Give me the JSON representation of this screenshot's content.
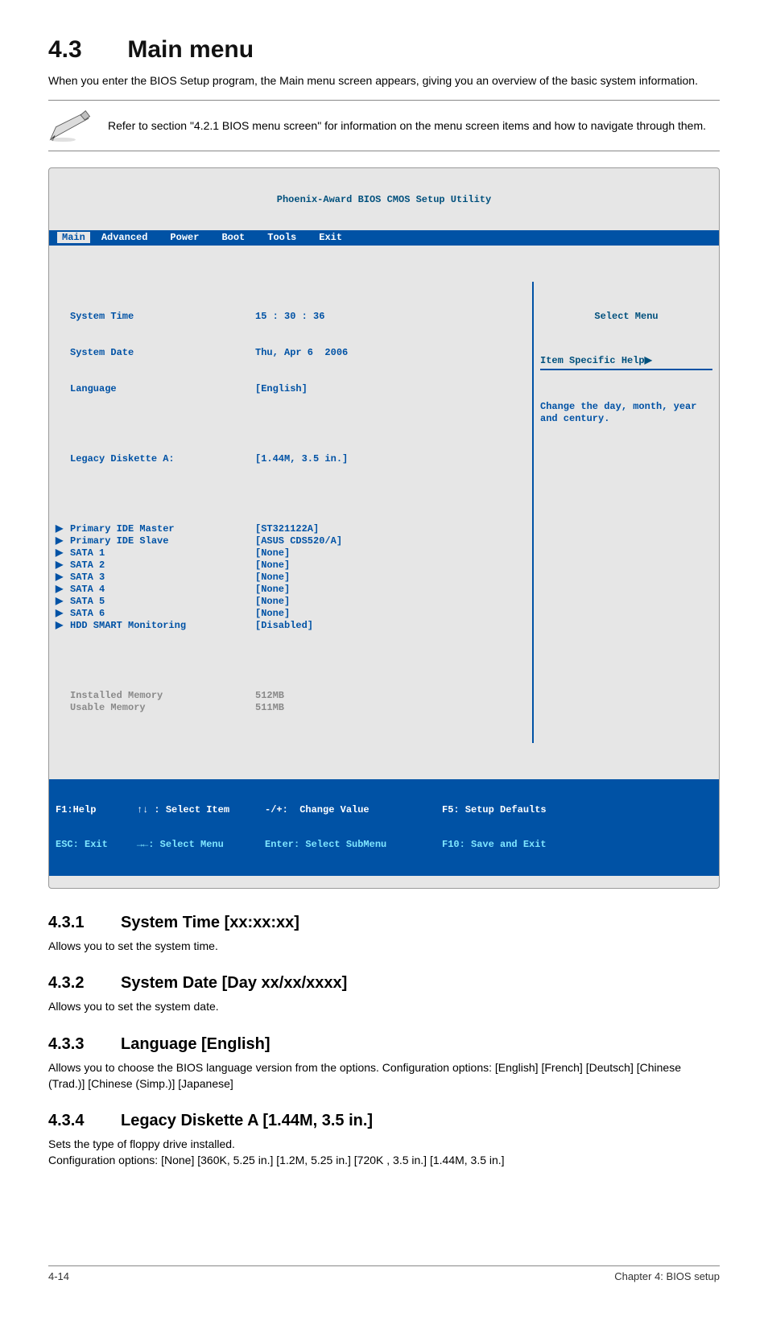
{
  "section": {
    "number": "4.3",
    "title": "Main menu"
  },
  "intro": "When you enter the BIOS Setup program, the Main menu screen appears, giving you an overview of the basic system information.",
  "note": "Refer to section \"4.2.1 BIOS menu screen\" for information on the menu screen items and how to navigate through them.",
  "bios": {
    "title": "Phoenix-Award BIOS CMOS Setup Utility",
    "menu": [
      "Main",
      "Advanced",
      "Power",
      "Boot",
      "Tools",
      "Exit"
    ],
    "active_menu": "Main",
    "fields": {
      "system_time_label": "System Time",
      "system_time_value": "15 : 30 : 36",
      "system_date_label": "System Date",
      "system_date_value": "Thu, Apr 6  2006",
      "language_label": "Language",
      "language_value": "[English]",
      "legacy_label": "Legacy Diskette A:",
      "legacy_value": "[1.44M, 3.5 in.]"
    },
    "subitems": [
      {
        "label": "Primary IDE Master",
        "value": "[ST321122A]"
      },
      {
        "label": "Primary IDE Slave",
        "value": "[ASUS CDS520/A]"
      },
      {
        "label": "SATA 1",
        "value": "[None]"
      },
      {
        "label": "SATA 2",
        "value": "[None]"
      },
      {
        "label": "SATA 3",
        "value": "[None]"
      },
      {
        "label": "SATA 4",
        "value": "[None]"
      },
      {
        "label": "SATA 5",
        "value": "[None]"
      },
      {
        "label": "SATA 6",
        "value": "[None]"
      },
      {
        "label": "HDD SMART Monitoring",
        "value": "[Disabled]"
      }
    ],
    "dim_rows": [
      {
        "label": "Installed Memory",
        "value": "512MB"
      },
      {
        "label": "Usable Memory",
        "value": "511MB"
      }
    ],
    "help": {
      "select_menu": "Select Menu",
      "item_specific": "Item Specific Help",
      "body": "Change the day, month, year and century."
    },
    "footer": {
      "line1_left": "F1:Help       ↑↓ : Select Item",
      "line1_mid": "-/+:  Change Value",
      "line1_right": "F5: Setup Defaults",
      "line2_left": "ESC: Exit     →←: Select Menu",
      "line2_mid": "Enter: Select SubMenu",
      "line2_right": "F10: Save and Exit"
    }
  },
  "subs": [
    {
      "num": "4.3.1",
      "title": "System Time [xx:xx:xx]",
      "body": "Allows you to set the system time."
    },
    {
      "num": "4.3.2",
      "title": "System Date [Day xx/xx/xxxx]",
      "body": "Allows you to set the system date."
    },
    {
      "num": "4.3.3",
      "title": "Language [English]",
      "body": "Allows you to choose the BIOS language version from the options. Configuration options: [English] [French] [Deutsch] [Chinese (Trad.)] [Chinese (Simp.)] [Japanese]"
    },
    {
      "num": "4.3.4",
      "title": "Legacy Diskette A [1.44M, 3.5 in.]",
      "body": "Sets the type of floppy drive installed.\nConfiguration options: [None] [360K, 5.25 in.]  [1.2M, 5.25 in.] [720K , 3.5 in.] [1.44M, 3.5 in.]"
    }
  ],
  "footer": {
    "left": "4-14",
    "right": "Chapter 4: BIOS setup"
  }
}
